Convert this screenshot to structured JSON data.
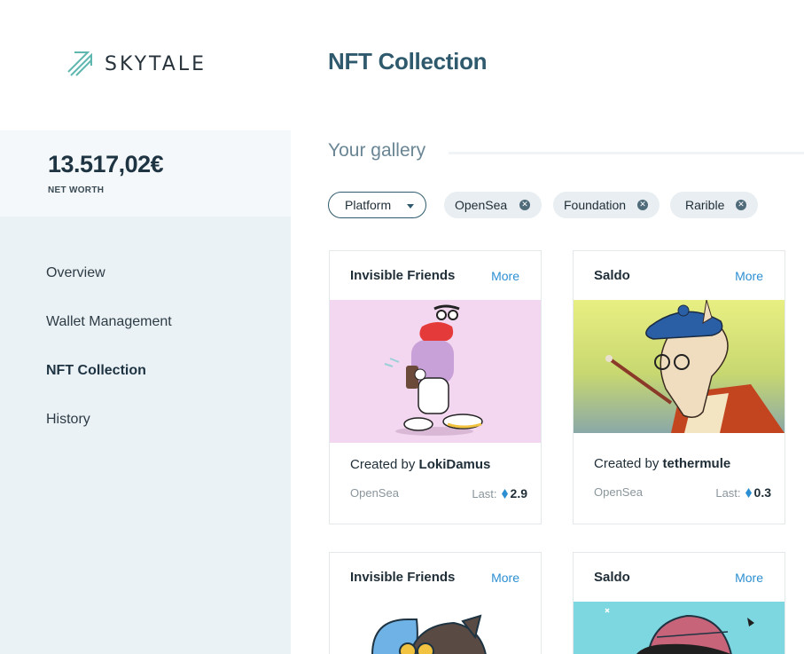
{
  "brand": {
    "name": "SKYTALE"
  },
  "header": {
    "title": "NFT Collection"
  },
  "summary": {
    "net_worth_value": "13.517,02€",
    "net_worth_label": "NET WORTH"
  },
  "nav": {
    "items": [
      {
        "label": "Overview",
        "active": false
      },
      {
        "label": "Wallet Management",
        "active": false
      },
      {
        "label": "NFT Collection",
        "active": true
      },
      {
        "label": "History",
        "active": false
      }
    ]
  },
  "gallery": {
    "title": "Your gallery",
    "platform_dropdown": "Platform",
    "filters": [
      "OpenSea",
      "Foundation",
      "Rarible"
    ]
  },
  "cards": [
    {
      "collection": "Invisible Friends",
      "more": "More",
      "created_prefix": "Created by ",
      "creator": "LokiDamus",
      "platform": "OpenSea",
      "last_label": "Last:",
      "price": "2.9"
    },
    {
      "collection": "Saldo",
      "more": "More",
      "created_prefix": "Created by ",
      "creator": "tethermule",
      "platform": "OpenSea",
      "last_label": "Last:",
      "price": "0.3"
    },
    {
      "collection": "Invisible Friends",
      "more": "More"
    },
    {
      "collection": "Saldo",
      "more": "More"
    }
  ],
  "colors": {
    "accent": "#2f5a6d",
    "link": "#2c8fd1",
    "sidebar": "#ebf2f5",
    "eth": "#2c8fd1"
  }
}
